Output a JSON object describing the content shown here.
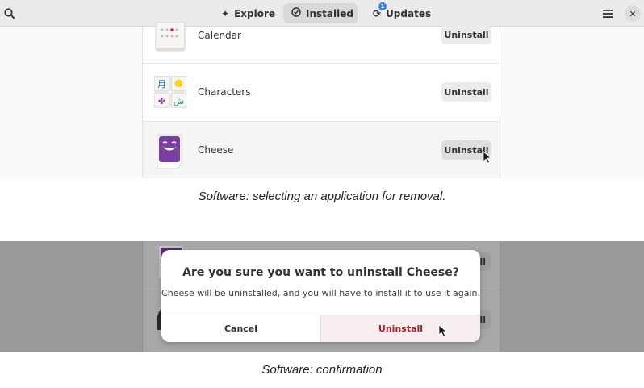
{
  "top_screenshot": {
    "header": {
      "search_icon": "search-icon",
      "tabs": [
        {
          "label": "Explore",
          "icon": "compass-star-icon"
        },
        {
          "label": "Installed",
          "icon": "check-circle-icon",
          "active": true
        },
        {
          "label": "Updates",
          "icon": "refresh-icon",
          "badge": "1"
        }
      ],
      "menu_icon": "hamburger-menu-icon",
      "close_icon": "close-icon"
    },
    "apps": [
      {
        "name": "Calendar",
        "action": "Uninstall",
        "icon": "calendar-icon"
      },
      {
        "name": "Characters",
        "action": "Uninstall",
        "icon": "characters-icon",
        "glyphs": [
          "月",
          "😀",
          "✤",
          "ش"
        ]
      },
      {
        "name": "Cheese",
        "action": "Uninstall",
        "icon": "cheese-icon",
        "hovered": true
      }
    ],
    "caption": "Software: selecting an application for removal."
  },
  "bottom_screenshot": {
    "background_buttons": [
      "ll",
      "ll"
    ],
    "dialog": {
      "title": "Are you sure you want to uninstall Cheese?",
      "body": "Cheese will be uninstalled, and you will have to install it to use it again.",
      "cancel_label": "Cancel",
      "confirm_label": "Uninstall"
    },
    "caption": "Software: confirmation"
  },
  "colors": {
    "destructive": "#a51d2d",
    "accent": "#3584e4",
    "cheese_purple": "#7b3fa0"
  }
}
